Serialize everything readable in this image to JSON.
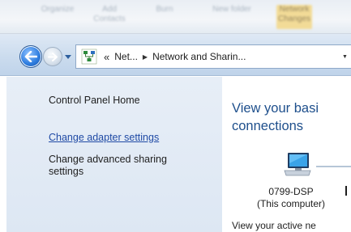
{
  "taskbar": {
    "items": [
      "Organize",
      "Add Contacts",
      "Burn",
      "New folder"
    ],
    "active_item": "Network Changes"
  },
  "nav": {
    "breadcrumbs": [
      {
        "label": "Net..."
      },
      {
        "label": "Network and Sharin..."
      }
    ],
    "overflow_glyph": "«"
  },
  "left_pane": {
    "home_label": "Control Panel Home",
    "adapter_link": "Change adapter settings",
    "sharing_link": "Change advanced sharing settings"
  },
  "main": {
    "heading_line1": "View your basi",
    "heading_line2": "connections",
    "computer_name": "0799-DSP",
    "computer_sub": "(This computer)",
    "active_networks": "View your active ne"
  },
  "colors": {
    "link": "#1f4aa5",
    "heading": "#1e4f8c",
    "left_pane_bg": "#e2eaf5"
  },
  "icons": [
    "back-arrow-icon",
    "forward-arrow-icon",
    "network-folder-icon",
    "computer-icon"
  ]
}
